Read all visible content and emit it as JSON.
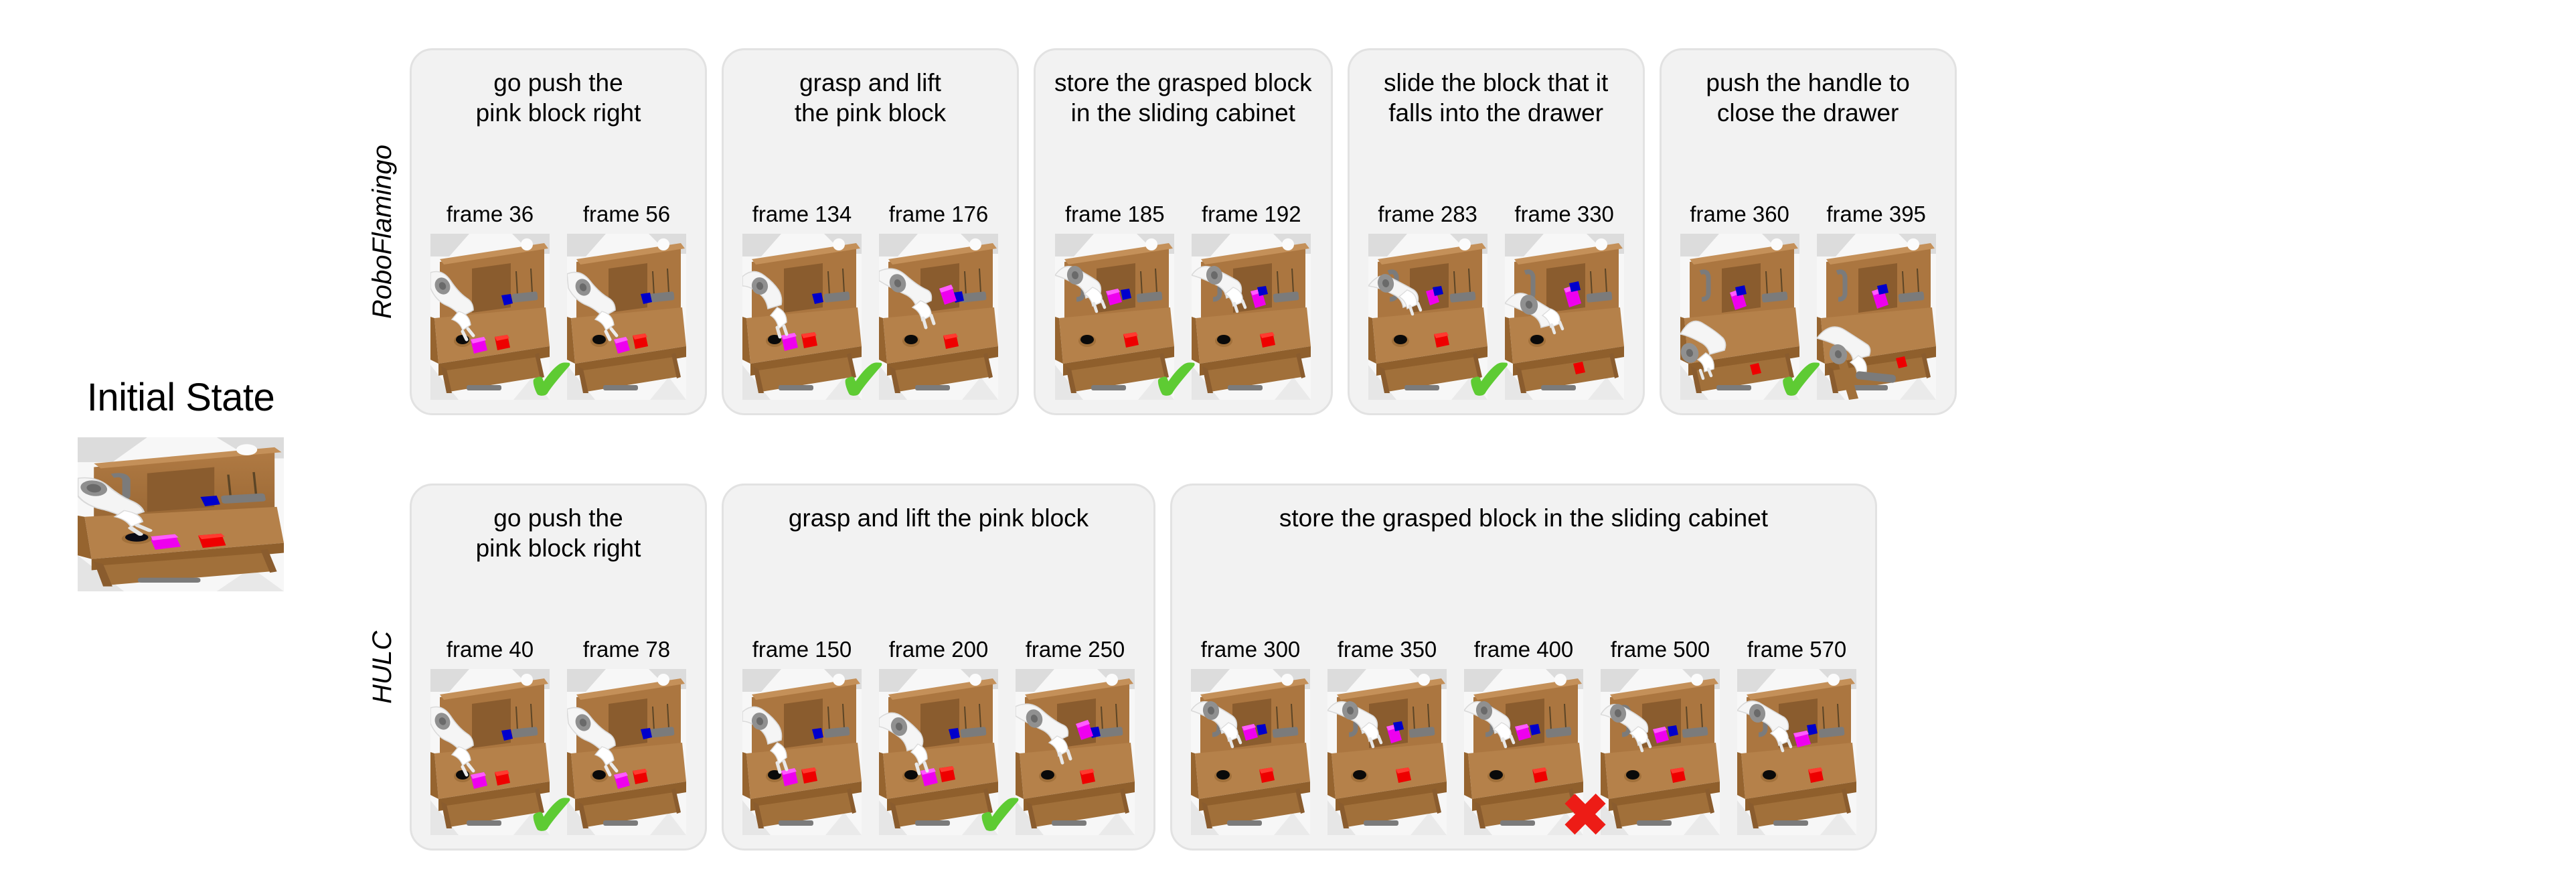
{
  "initial_state": {
    "title": "Initial State",
    "thumb_name": "initial-state-thumbnail"
  },
  "rows": [
    {
      "model": "RoboFlamingo",
      "panels": [
        {
          "instruction": "go push the\npink block right",
          "verdict": "success",
          "verdict_glyph": "✔",
          "verdict_under_index": 0,
          "frames": [
            {
              "label": "frame 36"
            },
            {
              "label": "frame 56"
            }
          ]
        },
        {
          "instruction": "grasp and lift\nthe pink block",
          "verdict": "success",
          "verdict_glyph": "✔",
          "verdict_under_index": 0,
          "frames": [
            {
              "label": "frame 134"
            },
            {
              "label": "frame 176"
            }
          ]
        },
        {
          "instruction": "store the grasped block\nin the sliding cabinet",
          "verdict": "success",
          "verdict_glyph": "✔",
          "verdict_under_index": 0,
          "frames": [
            {
              "label": "frame 185"
            },
            {
              "label": "frame 192"
            }
          ]
        },
        {
          "instruction": "slide the block that it\nfalls into the drawer",
          "verdict": "success",
          "verdict_glyph": "✔",
          "verdict_under_index": 0,
          "frames": [
            {
              "label": "frame 283"
            },
            {
              "label": "frame 330"
            }
          ]
        },
        {
          "instruction": "push the handle to\nclose the drawer",
          "verdict": "success",
          "verdict_glyph": "✔",
          "verdict_under_index": 0,
          "frames": [
            {
              "label": "frame 360"
            },
            {
              "label": "frame 395"
            }
          ]
        }
      ]
    },
    {
      "model": "HULC",
      "panels": [
        {
          "instruction": "go push the\npink block right",
          "verdict": "success",
          "verdict_glyph": "✔",
          "verdict_under_index": 0,
          "frames": [
            {
              "label": "frame 40"
            },
            {
              "label": "frame 78"
            }
          ]
        },
        {
          "instruction": "grasp and lift the pink block",
          "verdict": "success",
          "verdict_glyph": "✔",
          "verdict_under_index": 1,
          "frames": [
            {
              "label": "frame 150"
            },
            {
              "label": "frame 200"
            },
            {
              "label": "frame 250"
            }
          ]
        },
        {
          "instruction": "store the grasped block in the sliding cabinet",
          "verdict": "failure",
          "verdict_glyph": "✖",
          "verdict_under_index": 2,
          "frames": [
            {
              "label": "frame 300"
            },
            {
              "label": "frame 350"
            },
            {
              "label": "frame 400"
            },
            {
              "label": "frame 500"
            },
            {
              "label": "frame 570"
            }
          ]
        }
      ]
    }
  ],
  "colors": {
    "panel_background": "#f2f2f2",
    "panel_border": "#e2e2e2",
    "success_check": "#5ECB33",
    "failure_cross": "#ED1C16",
    "text": "#000000",
    "scene_wood": "#a9743f",
    "scene_wood_dark": "#8a5c2e",
    "scene_wood_light": "#c08b52",
    "scene_robot": "#f2f2f2",
    "scene_robot_gray": "#8f8f8f",
    "block_pink": "#ee00ee",
    "block_blue": "#0000cc",
    "block_red": "#ee0000",
    "block_black": "#000000",
    "floor": "#f8f8f8",
    "floor_tile": "#d8d8d8"
  },
  "scene_defs": {
    "note": "Each thumbnail renders a CALVIN tabletop simulation scene: a wooden desk with a sliding cabinet, a drawer, a light switch and button, plus pink / blue / red blocks and a Franka Panda robot arm.",
    "variants": [
      "arm-left-pushing-pink",
      "arm-left-pushing-pink-right",
      "arm-reaching-pink",
      "arm-lifted-pink",
      "arm-pink-in-cabinet",
      "arm-pink-in-cabinet-b",
      "arm-sliding-drawer",
      "arm-drawer-open-red-fallen",
      "arm-low-drawer-handle",
      "arm-drawer-closed"
    ]
  }
}
